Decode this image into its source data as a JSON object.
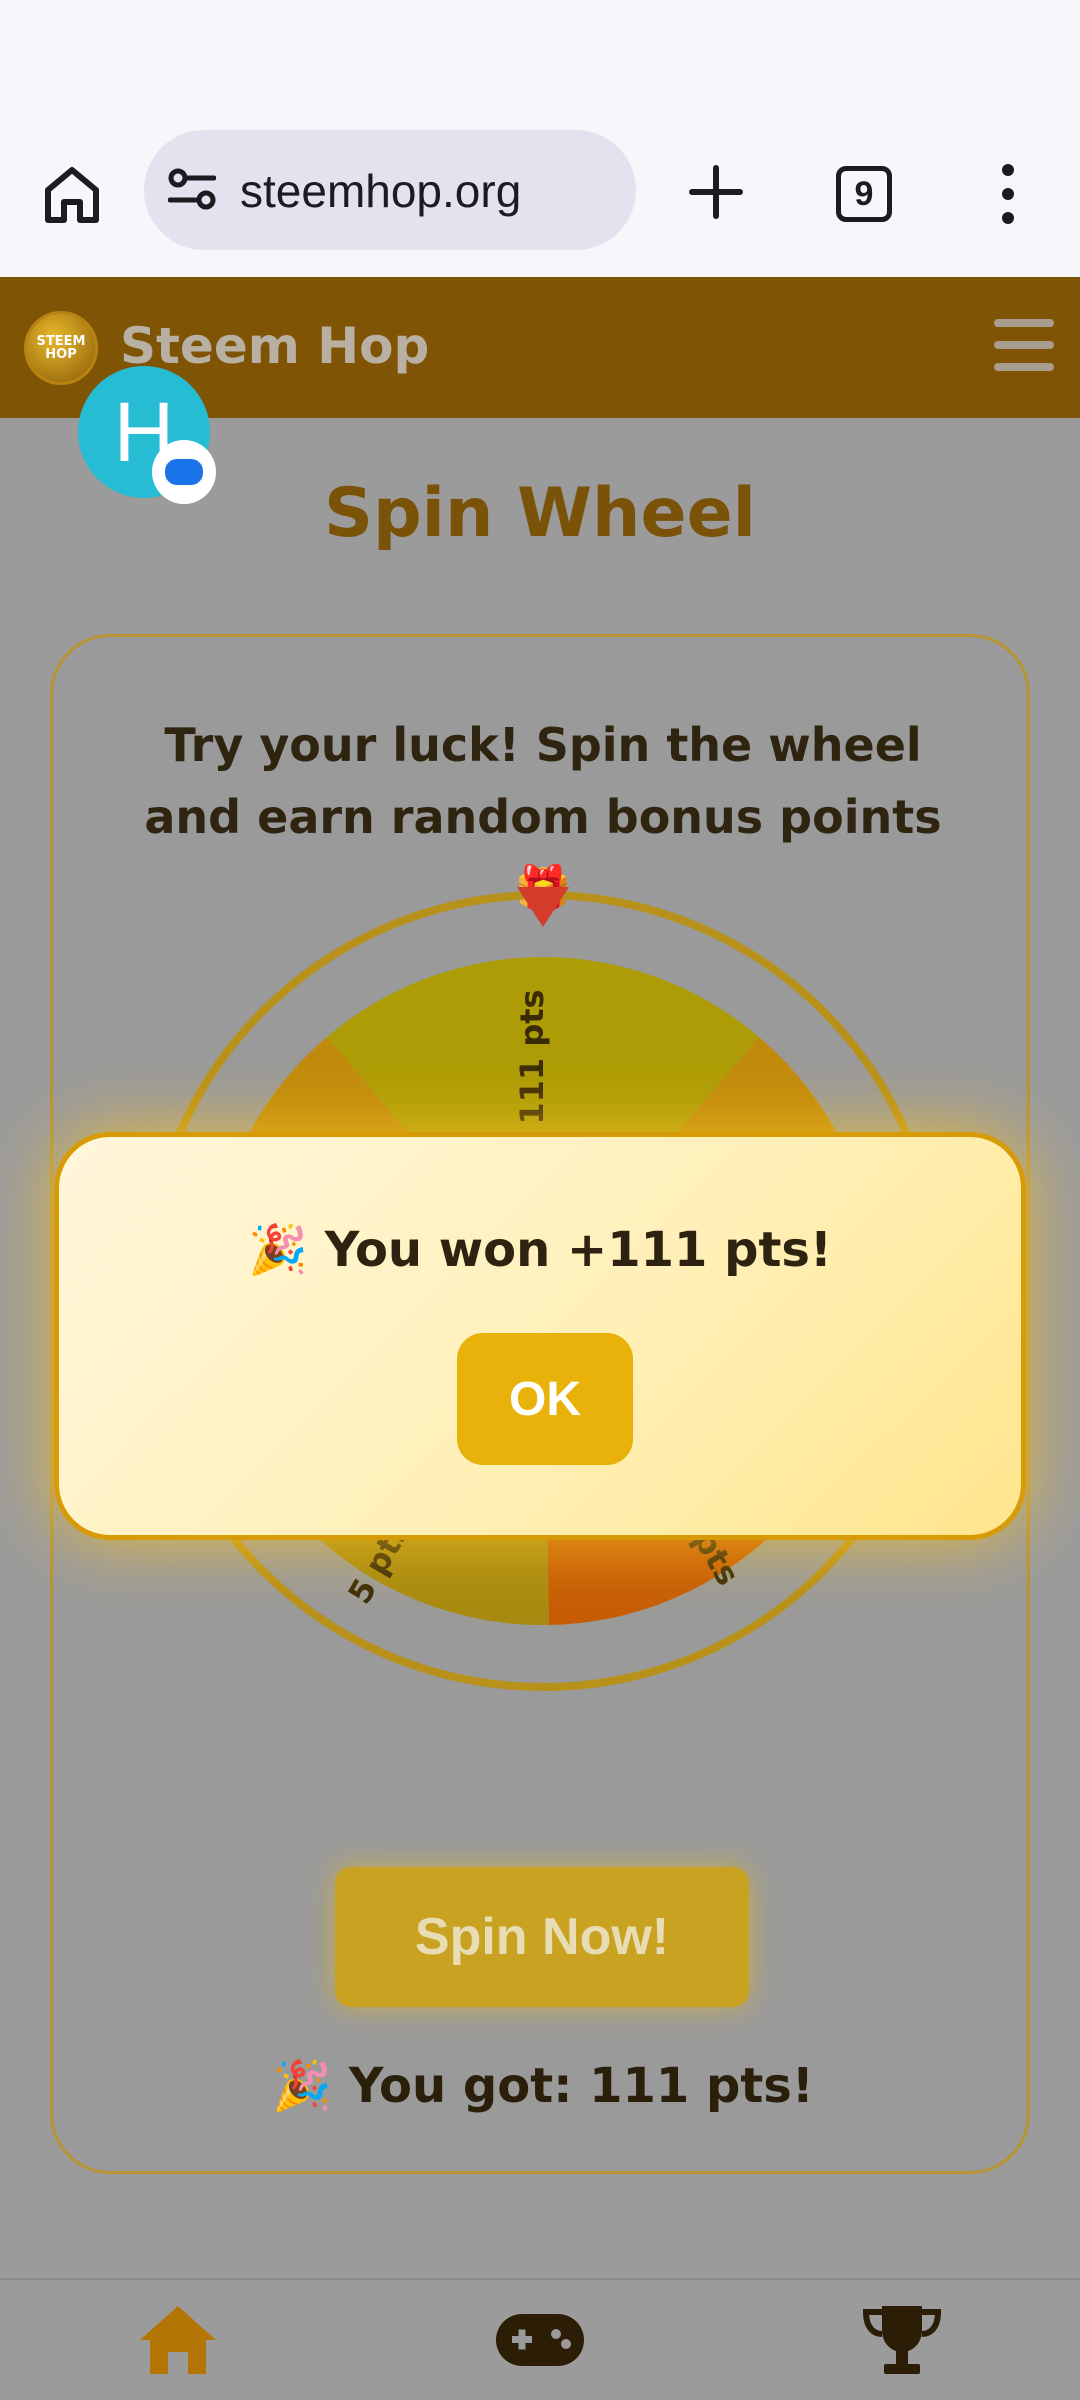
{
  "browser": {
    "url": "steemhop.org",
    "tab_count": "9"
  },
  "header": {
    "logo_text": "STEEM HOP",
    "site_name": "Steem Hop"
  },
  "page": {
    "title": "Spin Wheel",
    "description": "Try your luck! Spin the wheel and earn random bonus points 🎁",
    "spin_button": "Spin Now!",
    "result": "🎉 You got: 111 pts!"
  },
  "wheel": {
    "visible_labels": [
      "111 pts",
      "5 pts",
      "pts"
    ],
    "colors": {
      "rim": "#b8911a",
      "segment_a": "#ad9c06",
      "segment_b": "#c08a0c",
      "segment_c": "#a78a10",
      "segment_d": "#c65d06",
      "pointer": "#d43c2c"
    }
  },
  "popup": {
    "message": "🎉 You won +111 pts!",
    "ok_label": "OK"
  },
  "chat_head": {
    "initial": "H"
  },
  "bottom_nav": {
    "items": [
      {
        "icon": "home-icon",
        "color": "#b57504"
      },
      {
        "icon": "gamepad-icon",
        "color": "#2b1d06"
      },
      {
        "icon": "trophy-icon",
        "color": "#2b1d06"
      }
    ]
  }
}
